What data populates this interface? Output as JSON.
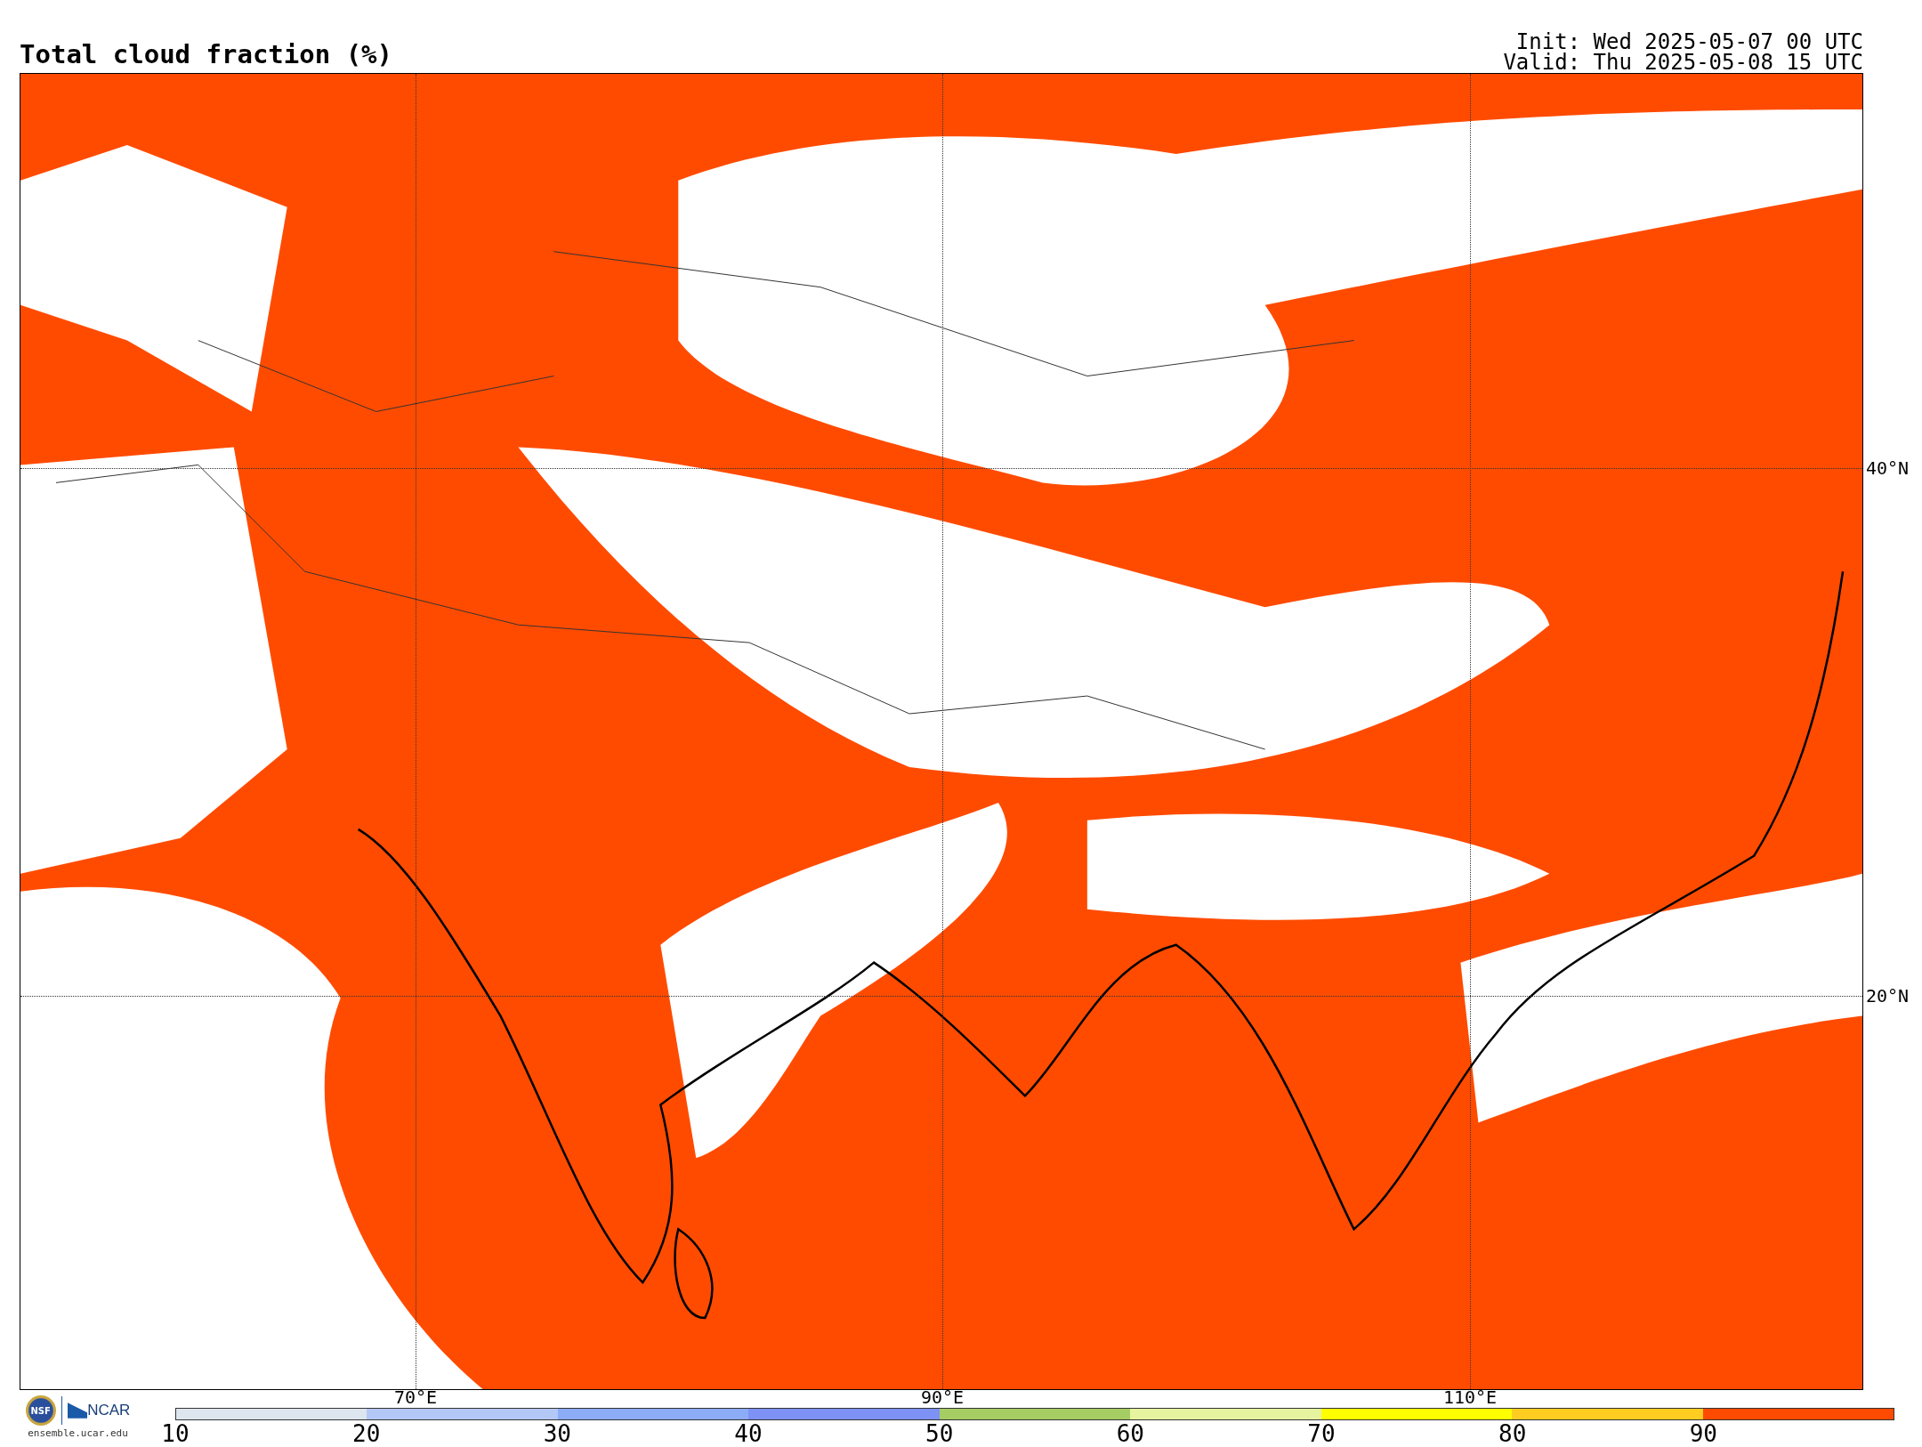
{
  "title": "Total cloud fraction (%)",
  "init": "Init: Wed 2025-05-07 00 UTC",
  "valid": "Valid: Thu 2025-05-08 15 UTC",
  "map": {
    "lon_labels": [
      "70°E",
      "90°E",
      "110°E"
    ],
    "lat_labels": [
      "40°N",
      "20°N"
    ]
  },
  "logo": {
    "left": "NSF",
    "right": "NCAR",
    "url": "ensemble.ucar.edu"
  },
  "colorbar": {
    "segments": [
      {
        "color": "#dde6ee"
      },
      {
        "color": "#b4c8f8"
      },
      {
        "color": "#8cacf8"
      },
      {
        "color": "#7d92f4"
      },
      {
        "color": "#a6cc64"
      },
      {
        "color": "#e6f4a0"
      },
      {
        "color": "#ffff00"
      },
      {
        "color": "#ffcc22"
      },
      {
        "color": "#ff4b00"
      }
    ],
    "ticks": [
      "10",
      "20",
      "30",
      "40",
      "50",
      "60",
      "70",
      "80",
      "90"
    ]
  }
}
